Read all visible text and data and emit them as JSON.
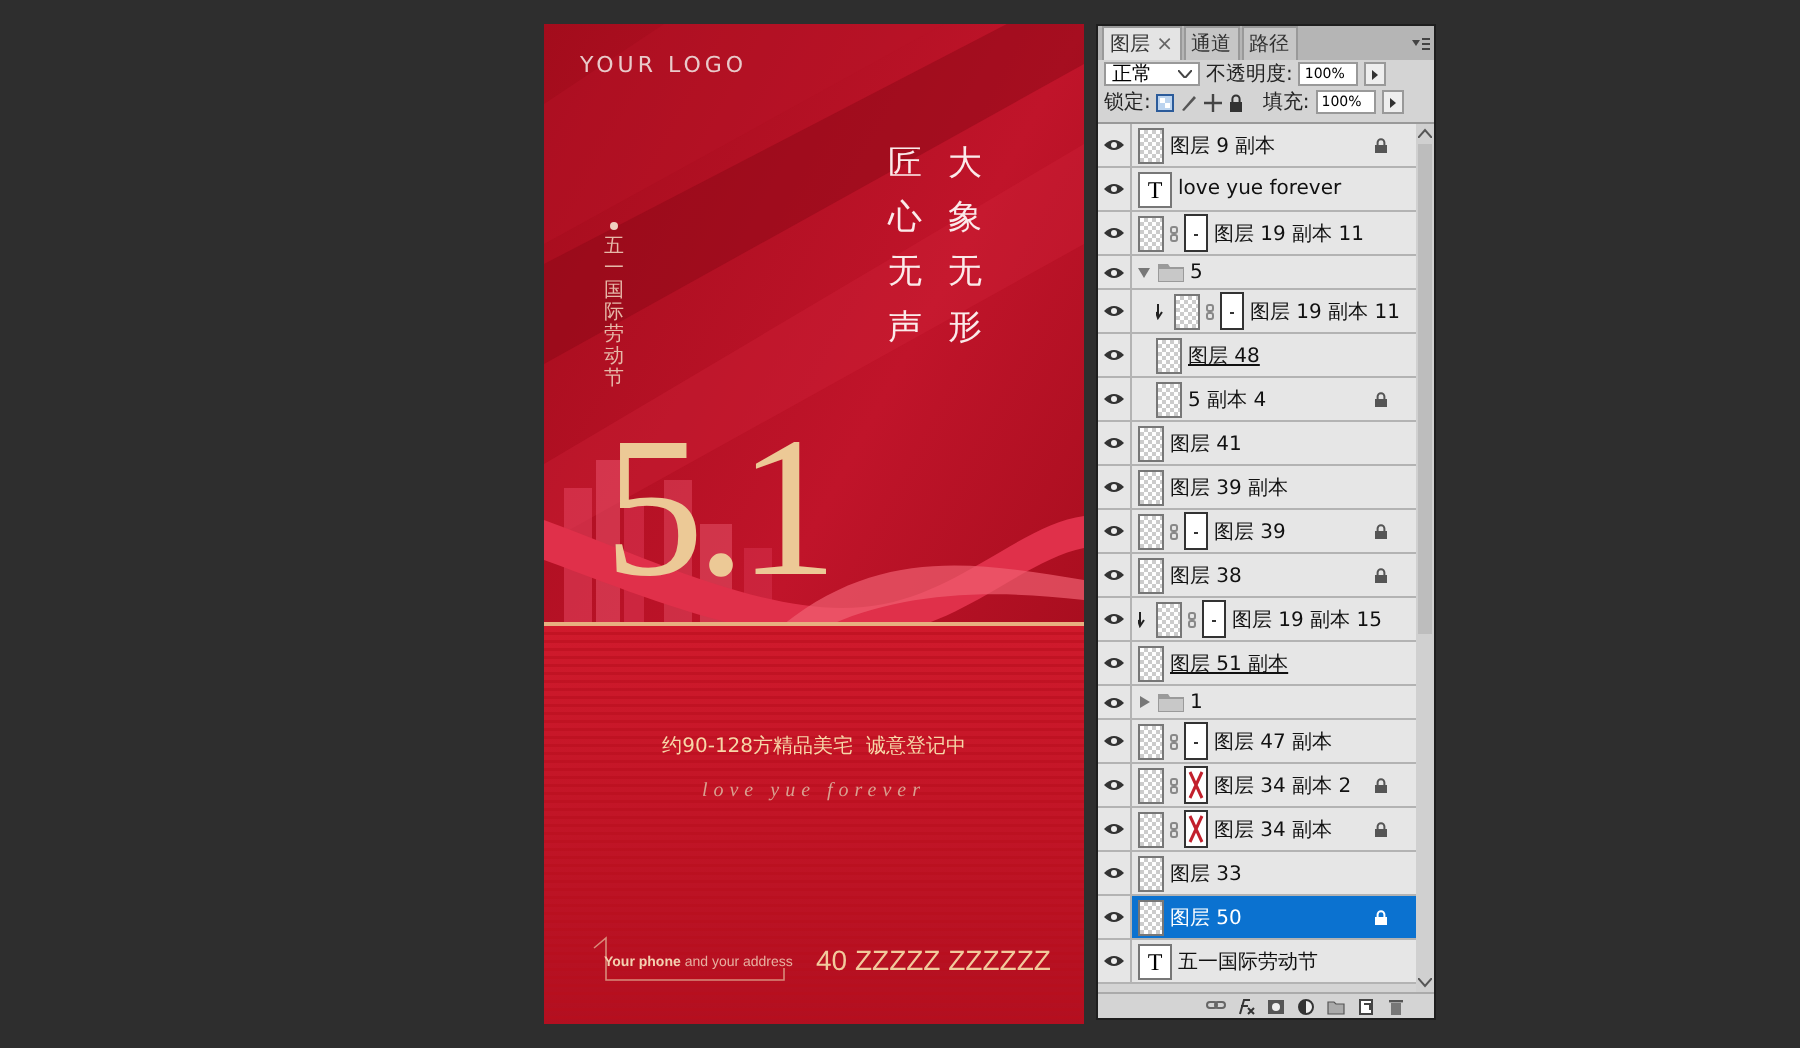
{
  "canvas": {
    "logo": "YOUR LOGO",
    "slogan_left": "匠心无声",
    "slogan_right": "大象无形",
    "festival": "五一国际劳动节",
    "headline": "5.1",
    "tagline": "约90-128方精品美宅  诚意登记中",
    "script_line": "love yue forever",
    "contact": "**Your phone** and your address",
    "phone": "40 ZZZZZ ZZZZZZ"
  },
  "layers_panel": {
    "tabs": [
      {
        "label": "图层",
        "close": "×",
        "selected": true
      },
      {
        "label": "通道",
        "selected": false
      },
      {
        "label": "路径",
        "selected": false
      }
    ],
    "blend_mode": "正常",
    "opacity_label": "不透明度:",
    "opacity": "100%",
    "lock_label": "锁定:",
    "fill_label": "填充:",
    "fill": "100%",
    "layers": [
      {
        "kind": "layer",
        "name": "图层 9 副本",
        "visible": true,
        "locked": true,
        "selected": false
      },
      {
        "kind": "text",
        "name": "love yue forever",
        "thumb": "T",
        "visible": true,
        "selected": false
      },
      {
        "kind": "layer",
        "name": "图层 19 副本 11",
        "mask": true,
        "visible": true,
        "selected": false
      },
      {
        "kind": "group",
        "name": "5",
        "expanded": true,
        "visible": true,
        "selected": false,
        "children": [
          {
            "kind": "layer",
            "name": "图层 19 副本 11",
            "mask": true,
            "clipped": true,
            "visible": true,
            "selected": false
          },
          {
            "kind": "layer",
            "name": "图层 48",
            "clip_base": true,
            "visible": true,
            "selected": false
          },
          {
            "kind": "layer",
            "name": "5 副本 4",
            "locked": true,
            "visible": true,
            "selected": false
          }
        ]
      },
      {
        "kind": "layer",
        "name": "图层 41",
        "visible": true,
        "selected": false
      },
      {
        "kind": "layer",
        "name": "图层 39 副本",
        "visible": true,
        "selected": false
      },
      {
        "kind": "layer",
        "name": "图层 39",
        "mask": true,
        "locked": true,
        "visible": true,
        "selected": false
      },
      {
        "kind": "layer",
        "name": "图层 38",
        "locked": true,
        "visible": true,
        "selected": false
      },
      {
        "kind": "layer",
        "name": "图层 19 副本 15",
        "mask": true,
        "clipped": true,
        "visible": true,
        "selected": false
      },
      {
        "kind": "layer",
        "name": "图层 51 副本",
        "clip_base": true,
        "visible": true,
        "selected": false
      },
      {
        "kind": "group",
        "name": "1",
        "expanded": false,
        "visible": true,
        "selected": false
      },
      {
        "kind": "layer",
        "name": "图层 47 副本",
        "mask": true,
        "visible": true,
        "selected": false
      },
      {
        "kind": "layer",
        "name": "图层 34 副本 2",
        "mask": true,
        "mask_cross": true,
        "locked": true,
        "visible": true,
        "selected": false
      },
      {
        "kind": "layer",
        "name": "图层 34 副本",
        "mask": true,
        "mask_cross": true,
        "locked": true,
        "visible": true,
        "selected": false
      },
      {
        "kind": "layer",
        "name": "图层 33",
        "visible": true,
        "selected": false
      },
      {
        "kind": "layer",
        "name": "图层 50",
        "locked": true,
        "visible": true,
        "selected": true
      },
      {
        "kind": "text",
        "name": "五一国际劳动节",
        "thumb": "T",
        "visible": true,
        "selected": false
      }
    ]
  }
}
